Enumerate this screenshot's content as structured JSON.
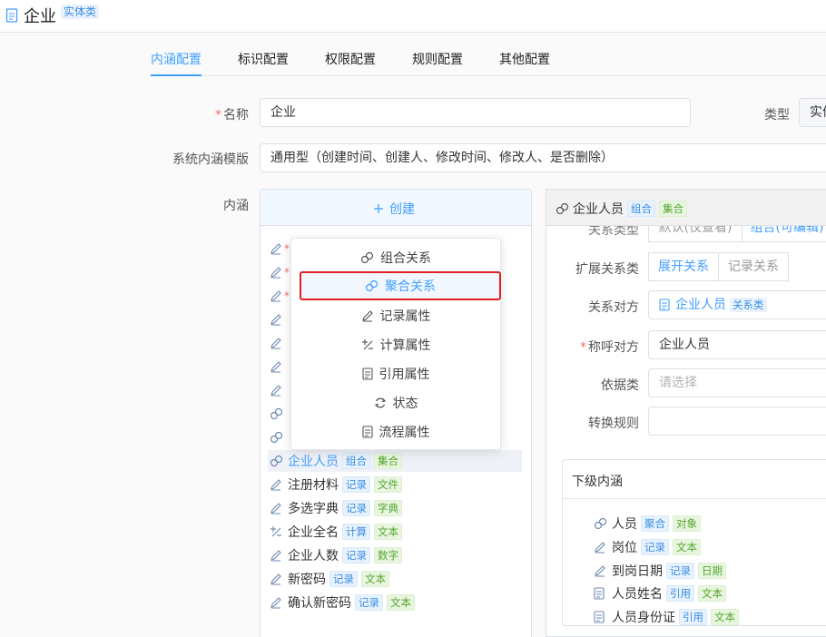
{
  "header": {
    "title": "企业",
    "type_tag": "实体类"
  },
  "tabs": [
    "内涵配置",
    "标识配置",
    "权限配置",
    "规则配置",
    "其他配置"
  ],
  "form": {
    "name_label": "名称",
    "name_value": "企业",
    "type_label": "类型",
    "type_value": "实体",
    "template_label": "系统内涵模版",
    "template_value": "通用型（创建时间、创建人、修改时间、修改人、是否删除）",
    "content_label": "内涵"
  },
  "create_button": "创建",
  "menu": [
    {
      "icon": "link-icon",
      "label": "组合关系"
    },
    {
      "icon": "link-icon",
      "label": "聚合关系"
    },
    {
      "icon": "pencil-icon",
      "label": "记录属性"
    },
    {
      "icon": "calc-icon",
      "label": "计算属性"
    },
    {
      "icon": "document-icon",
      "label": "引用属性"
    },
    {
      "icon": "refresh-icon",
      "label": "状态"
    },
    {
      "icon": "document-icon",
      "label": "流程属性"
    }
  ],
  "list_items": [
    {
      "icon": "link-icon",
      "label": "企业人员",
      "tags": [
        "组合",
        "集合"
      ],
      "selected": true
    },
    {
      "icon": "pencil-icon",
      "label": "注册材料",
      "tags": [
        "记录",
        "文件"
      ]
    },
    {
      "icon": "pencil-icon",
      "label": "多选字典",
      "tags": [
        "记录",
        "字典"
      ]
    },
    {
      "icon": "calc-icon",
      "label": "企业全名",
      "tags": [
        "计算",
        "文本"
      ]
    },
    {
      "icon": "pencil-icon",
      "label": "企业人数",
      "tags": [
        "记录",
        "数字"
      ]
    },
    {
      "icon": "pencil-icon",
      "label": "新密码",
      "tags": [
        "记录",
        "文本"
      ]
    },
    {
      "icon": "pencil-icon",
      "label": "确认新密码",
      "tags": [
        "记录",
        "文本"
      ]
    }
  ],
  "detail": {
    "title": "企业人员",
    "title_tags": [
      "组合",
      "集合"
    ],
    "relation_type_label": "关系类型",
    "relation_type_options": [
      "默认(仅查看)",
      "组合(可编辑)"
    ],
    "expand_label": "扩展关系类",
    "expand_options": [
      "展开关系",
      "记录关系"
    ],
    "counterpart_label": "关系对方",
    "counterpart_value": "企业人员",
    "counterpart_tag": "关系类",
    "call_label": "称呼对方",
    "call_value": "企业人员",
    "basis_label": "依据类",
    "basis_placeholder": "请选择",
    "convert_label": "转换规则",
    "sub_title": "下级内涵",
    "sub_items": [
      {
        "icon": "link-icon",
        "label": "人员",
        "tags": [
          "聚合",
          "对象"
        ]
      },
      {
        "icon": "pencil-icon",
        "label": "岗位",
        "tags": [
          "记录",
          "文本"
        ]
      },
      {
        "icon": "pencil-icon",
        "label": "到岗日期",
        "tags": [
          "记录",
          "日期"
        ]
      },
      {
        "icon": "document-icon",
        "label": "人员姓名",
        "tags": [
          "引用",
          "文本"
        ]
      },
      {
        "icon": "document-icon",
        "label": "人员身份证",
        "tags": [
          "引用",
          "文本"
        ]
      }
    ]
  },
  "colors": {
    "accent": "#409eff",
    "highlight_border": "#e02020",
    "required": "#f56c6c"
  }
}
